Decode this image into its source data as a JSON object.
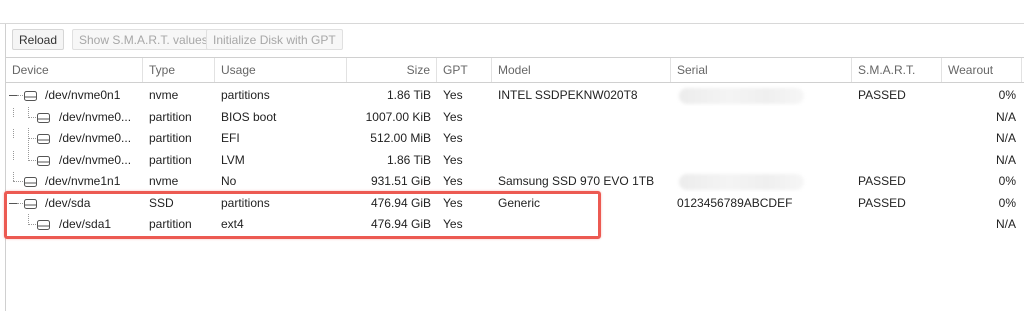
{
  "toolbar": {
    "reload": "Reload",
    "show_smart": "Show S.M.A.R.T. values",
    "init_gpt": "Initialize Disk with GPT"
  },
  "columns": {
    "device": "Device",
    "type": "Type",
    "usage": "Usage",
    "size": "Size",
    "gpt": "GPT",
    "model": "Model",
    "serial": "Serial",
    "smart": "S.M.A.R.T.",
    "wearout": "Wearout"
  },
  "rows": [
    {
      "device": "/dev/nvme0n1",
      "type": "nvme",
      "usage": "partitions",
      "size": "1.86 TiB",
      "gpt": "Yes",
      "model": "INTEL SSDPEKNW020T8",
      "serial": "",
      "smart": "PASSED",
      "wearout": "0%"
    },
    {
      "device": "/dev/nvme0...",
      "type": "partition",
      "usage": "BIOS boot",
      "size": "1007.00 KiB",
      "gpt": "Yes",
      "model": "",
      "serial": "",
      "smart": "",
      "wearout": "N/A"
    },
    {
      "device": "/dev/nvme0...",
      "type": "partition",
      "usage": "EFI",
      "size": "512.00 MiB",
      "gpt": "Yes",
      "model": "",
      "serial": "",
      "smart": "",
      "wearout": "N/A"
    },
    {
      "device": "/dev/nvme0...",
      "type": "partition",
      "usage": "LVM",
      "size": "1.86 TiB",
      "gpt": "Yes",
      "model": "",
      "serial": "",
      "smart": "",
      "wearout": "N/A"
    },
    {
      "device": "/dev/nvme1n1",
      "type": "nvme",
      "usage": "No",
      "size": "931.51 GiB",
      "gpt": "Yes",
      "model": "Samsung SSD 970 EVO 1TB",
      "serial": "",
      "smart": "PASSED",
      "wearout": "0%"
    },
    {
      "device": "/dev/sda",
      "type": "SSD",
      "usage": "partitions",
      "size": "476.94 GiB",
      "gpt": "Yes",
      "model": "Generic",
      "serial": "0123456789ABCDEF",
      "smart": "PASSED",
      "wearout": "0%"
    },
    {
      "device": "/dev/sda1",
      "type": "partition",
      "usage": "ext4",
      "size": "476.94 GiB",
      "gpt": "Yes",
      "model": "",
      "serial": "",
      "smart": "",
      "wearout": "N/A"
    }
  ],
  "colors": {
    "highlight": "#ec5a52"
  }
}
